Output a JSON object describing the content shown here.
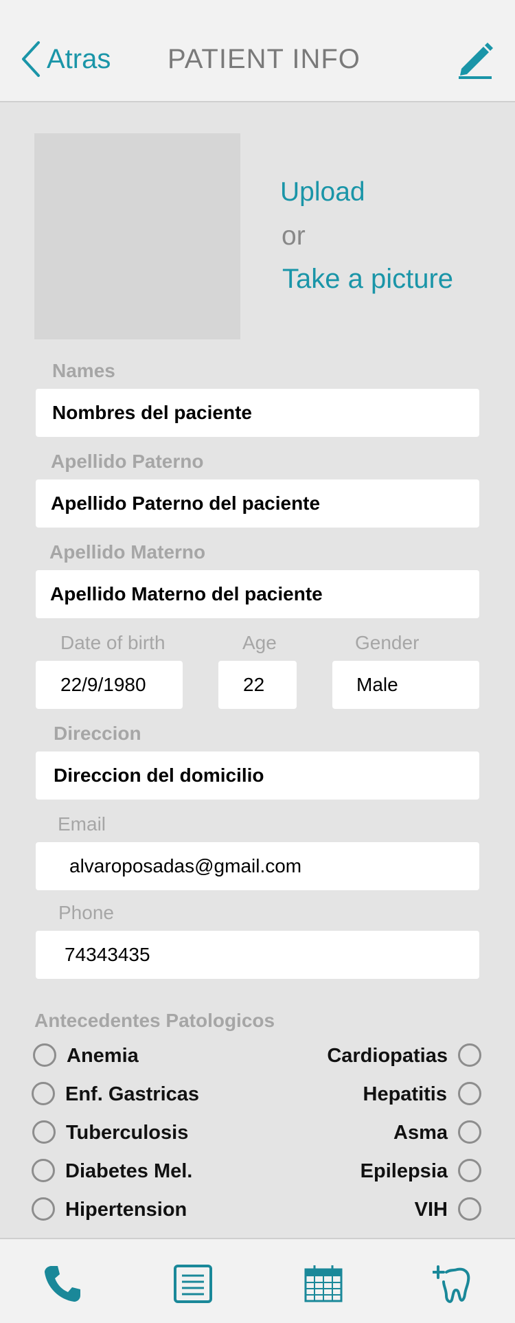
{
  "header": {
    "back_label": "Atras",
    "title": "PATIENT INFO"
  },
  "photo": {
    "upload_label": "Upload",
    "or_label": "or",
    "take_picture_label": "Take a picture"
  },
  "form": {
    "names": {
      "label": "Names",
      "value": "Nombres del paciente"
    },
    "apellido_paterno": {
      "label": "Apellido Paterno",
      "value": "Apellido Paterno del paciente"
    },
    "apellido_materno": {
      "label": "Apellido Materno",
      "value": "Apellido Materno del paciente"
    },
    "date_of_birth": {
      "label": "Date of birth",
      "value": "22/9/1980"
    },
    "age": {
      "label": "Age",
      "value": "22"
    },
    "gender": {
      "label": "Gender",
      "value": "Male"
    },
    "direccion": {
      "label": "Direccion",
      "value": "Direccion del domicilio"
    },
    "email": {
      "label": "Email",
      "value": "alvaroposadas@gmail.com"
    },
    "phone": {
      "label": "Phone",
      "value": "74343435"
    }
  },
  "antecedentes": {
    "title": "Antecedentes Patologicos",
    "left": [
      "Anemia",
      "Enf. Gastricas",
      "Tuberculosis",
      "Diabetes Mel.",
      "Hipertension"
    ],
    "right": [
      "Cardiopatias",
      "Hepatitis",
      "Asma",
      "Epilepsia",
      "VIH"
    ]
  },
  "footer": {
    "icons": [
      "phone-icon",
      "notes-icon",
      "calendar-icon",
      "dental-icon"
    ]
  },
  "colors": {
    "accent": "#1a95a8",
    "background": "#e4e4e4",
    "header_bg": "#f2f2f2",
    "label_gray": "#a6a6a6"
  }
}
